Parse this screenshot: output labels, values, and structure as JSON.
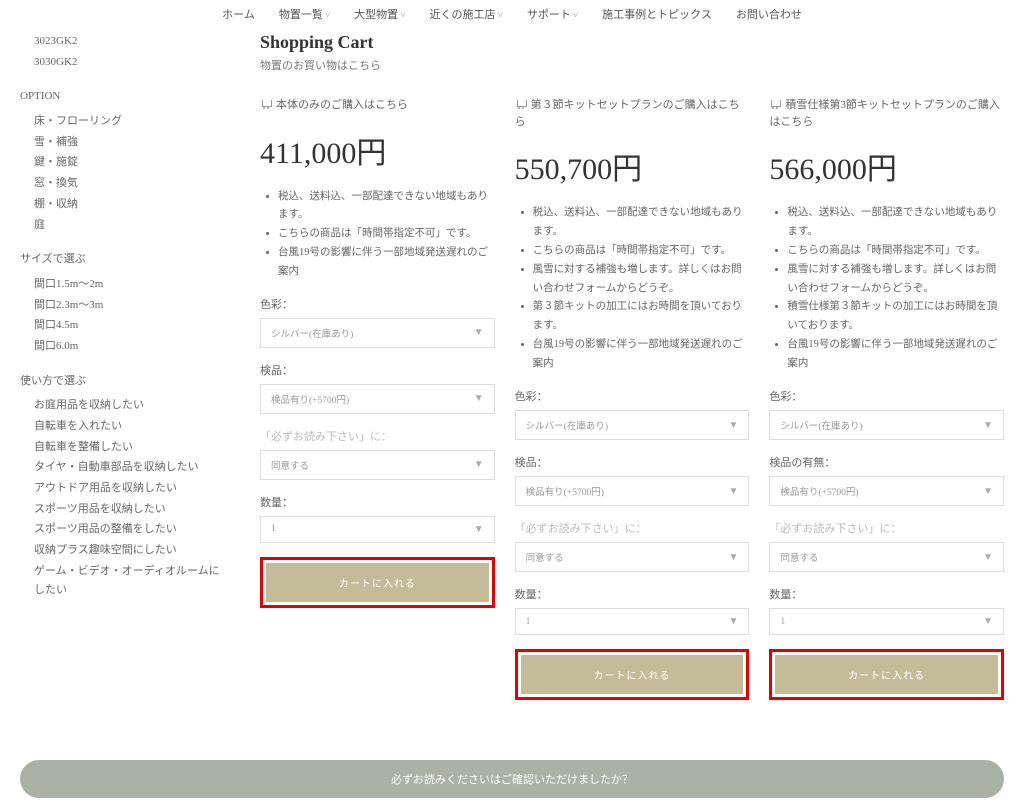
{
  "nav": {
    "items": [
      "ホーム",
      "物置一覧",
      "大型物置",
      "近くの施工店",
      "サポート",
      "施工事例とトピックス",
      "お問い合わせ"
    ],
    "dropdown": [
      false,
      true,
      true,
      true,
      true,
      false,
      false
    ]
  },
  "sidebar": {
    "models": [
      "3023GK2",
      "3030GK2"
    ],
    "option_hdr": "OPTION",
    "options": [
      "床・フローリング",
      "雪・補強",
      "鍵・施錠",
      "窓・換気",
      "棚・収納",
      "庭"
    ],
    "size_hdr": "サイズで選ぶ",
    "sizes": [
      "間口1.5m〜2m",
      "間口2.3m〜3m",
      "間口4.5m",
      "間口6.0m"
    ],
    "use_hdr": "使い方で選ぶ",
    "uses": [
      "お庭用品を収納したい",
      "自転車を入れたい",
      "自転車を整備したい",
      "タイヤ・自動車部品を収納したい",
      "アウトドア用品を収納したい",
      "スポーツ用品を収納したい",
      "スポーツ用品の整備をしたい",
      "収納プラス趣味空間にしたい",
      "ゲーム・ビデオ・オーディオルームにしたい"
    ]
  },
  "cart": {
    "title": "Shopping Cart",
    "subtitle": "物置のお買い物はこちら"
  },
  "cols": [
    {
      "title": "本体のみのご購入はこちら",
      "price": "411,000円",
      "bullets": [
        "税込、送料込、一部配達できない地域もあります。",
        "こちらの商品は「時間帯指定不可」です。",
        "台風19号の影響に伴う一部地域発送遅れのご案内"
      ],
      "fields": [
        {
          "label": "色彩：",
          "value": "シルバー(在庫あり)"
        },
        {
          "label": "検品：",
          "value": "検品有り(+5700円)"
        },
        {
          "label": "「必ずお読み下さい」に：",
          "muted": true,
          "value": "同意する"
        },
        {
          "label": "数量：",
          "value": "1"
        }
      ],
      "btn": "カートに入れる"
    },
    {
      "title": "第３節キットセットプランのご購入はこちら",
      "price": "550,700円",
      "bullets": [
        "税込、送料込、一部配達できない地域もあります。",
        "こちらの商品は「時間帯指定不可」です。",
        "風雪に対する補強も増します。詳しくはお問い合わせフォームからどうぞ。",
        "第３節キットの加工にはお時間を頂いております。",
        "台風19号の影響に伴う一部地域発送遅れのご案内"
      ],
      "fields": [
        {
          "label": "色彩：",
          "value": "シルバー(在庫あり)"
        },
        {
          "label": "検品：",
          "value": "検品有り(+5700円)"
        },
        {
          "label": "「必ずお読み下さい」に：",
          "muted": true,
          "value": "同意する"
        },
        {
          "label": "数量：",
          "value": "1"
        }
      ],
      "btn": "カートに入れる"
    },
    {
      "title": "積雪仕様第3節キットセットプランのご購入はこちら",
      "price": "566,000円",
      "bullets": [
        "税込、送料込、一部配達できない地域もあります。",
        "こちらの商品は「時間帯指定不可」です。",
        "風雪に対する補強も増します。詳しくはお問い合わせフォームからどうぞ。",
        "積雪仕様第３節キットの加工にはお時間を頂いております。",
        "台風19号の影響に伴う一部地域発送遅れのご案内"
      ],
      "fields": [
        {
          "label": "色彩：",
          "value": "シルバー(在庫あり)"
        },
        {
          "label": "検品の有無：",
          "value": "検品有り(+5700円)"
        },
        {
          "label": "「必ずお読み下さい」に：",
          "muted": true,
          "value": "同意する"
        },
        {
          "label": "数量：",
          "value": "1"
        }
      ],
      "btn": "カートに入れる"
    }
  ],
  "confirm": "必ずお読みくださいはご確認いただけましたか？"
}
